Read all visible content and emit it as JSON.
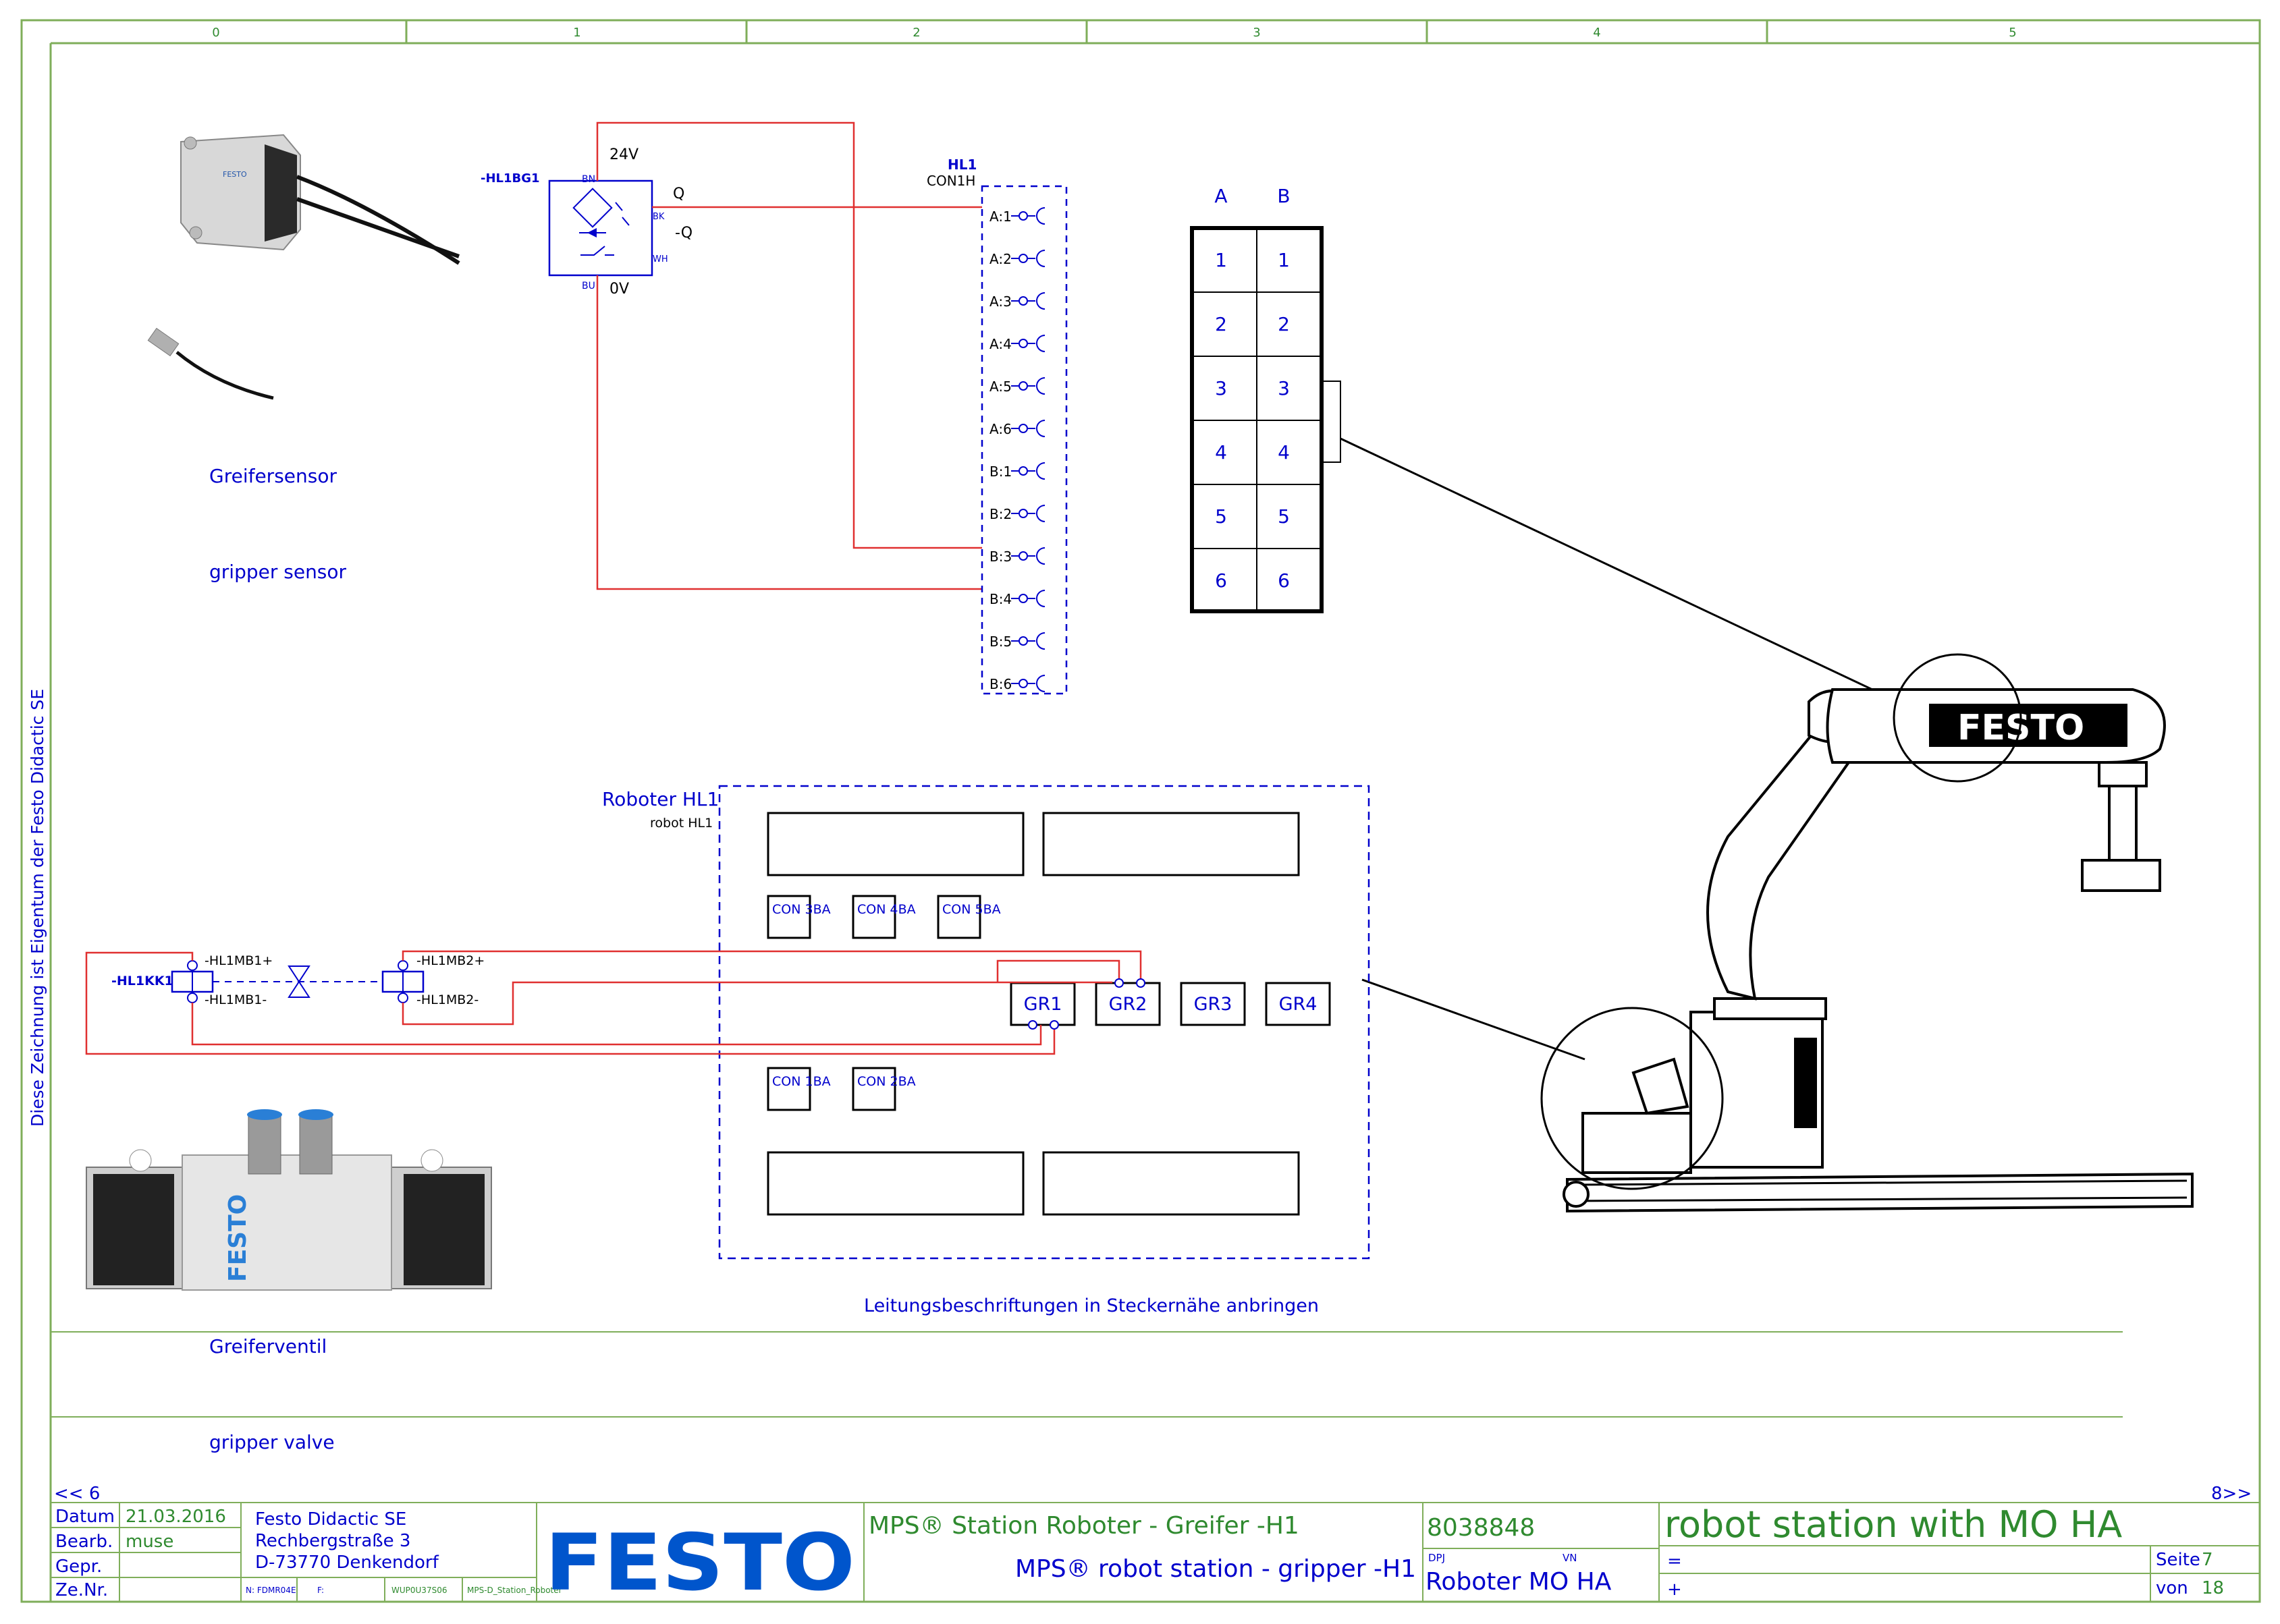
{
  "ruler": {
    "cols": [
      "0",
      "1",
      "2",
      "3",
      "4",
      "5"
    ]
  },
  "side_note": "Diese Zeichnung ist Eigentum der Festo Didactic SE",
  "captions": {
    "sensor_de": "Greifersensor",
    "sensor_en": "gripper sensor",
    "valve_de": "Greiferventil",
    "valve_en": "gripper valve",
    "label_note": "Leitungsbeschriftungen in Steckernähe anbringen"
  },
  "sensor": {
    "tag": "-HL1BG1",
    "v24": "24V",
    "v0": "0V",
    "q": "Q",
    "nq": "-Q",
    "bn": "BN",
    "bk": "BK",
    "wh": "WH",
    "bu": "BU"
  },
  "connector": {
    "tag": "HL1",
    "name": "CON1H",
    "pins": [
      "A:1",
      "A:2",
      "A:3",
      "A:4",
      "A:5",
      "A:6",
      "B:1",
      "B:2",
      "B:3",
      "B:4",
      "B:5",
      "B:6"
    ]
  },
  "pin_table": {
    "cols": [
      "A",
      "B"
    ],
    "rows": [
      "1",
      "2",
      "3",
      "4",
      "5",
      "6"
    ]
  },
  "robot": {
    "title": "Roboter HL1",
    "subtitle": "robot HL1",
    "con_top": [
      "CON 3BA",
      "CON 4BA",
      "CON 5BA"
    ],
    "con_bottom": [
      "CON 1BA",
      "CON 2BA"
    ],
    "grips": [
      "GR1",
      "GR2",
      "GR3",
      "GR4"
    ]
  },
  "valve": {
    "tag": "-HL1KK1",
    "mb1p": "-HL1MB1+",
    "mb1m": "-HL1MB1-",
    "mb2p": "-HL1MB2+",
    "mb2m": "-HL1MB2-"
  },
  "product_labels": {
    "festo_vertical": "FESTO",
    "robot_logo": "FESTO"
  },
  "nav": {
    "prev": "<< 6",
    "next": "8>>"
  },
  "title_block": {
    "datum_label": "Datum",
    "datum": "21.03.2016",
    "bearb_label": "Bearb.",
    "bearb": "muse",
    "gepr_label": "Gepr.",
    "zenr_label": "Ze.Nr.",
    "company": "Festo Didactic SE",
    "street": "Rechbergstraße 3",
    "city": "D-73770 Denkendorf",
    "fdm": "N: FDMR04E",
    "f": "F:",
    "wup": "WUP0U37S06",
    "file": "MPS-D_Station_Roboter",
    "logo": "FESTO",
    "title_de": "MPS® Station Roboter - Greifer -H1",
    "title_en": "MPS® robot station - gripper  -H1",
    "number": "8038848",
    "dpj": "DPJ",
    "vn": "VN",
    "unit": "Roboter MO HA",
    "heading": "robot station with MO HA",
    "eq": "=",
    "plus": "+",
    "seite_label": "Seite",
    "seite": "7",
    "von_label": "von",
    "von": "18"
  },
  "colors": {
    "frame": "#7fae5a",
    "text_green": "#2f8a2f",
    "blue": "#0000cc",
    "wire": "#e03030",
    "black": "#000000"
  }
}
